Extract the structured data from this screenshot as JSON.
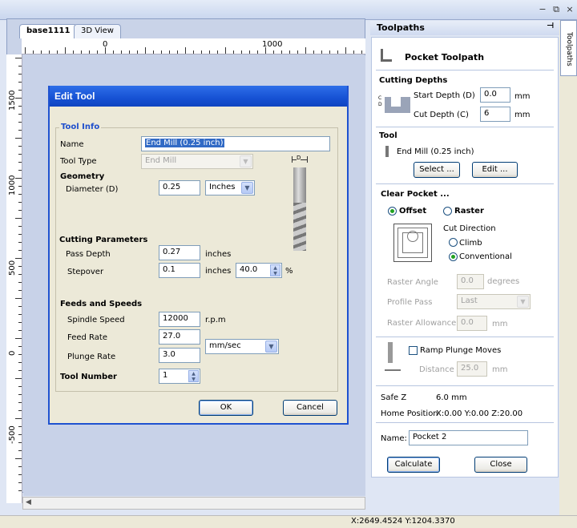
{
  "window": {
    "controls": [
      "−",
      "⧉",
      "×"
    ]
  },
  "document": {
    "tabs": [
      "base1111",
      "3D View"
    ],
    "ruler_h_labels": [
      "0",
      "1000"
    ],
    "ruler_v_labels": [
      "1500",
      "1000",
      "500",
      "0",
      "-500"
    ]
  },
  "status": {
    "coords": "X:2649.4524 Y:1204.3370"
  },
  "dialog": {
    "title": "Edit Tool",
    "tool_info_header": "Tool Info",
    "name_label": "Name",
    "name_value": "End Mill (0.25 inch)",
    "tool_type_label": "Tool Type",
    "tool_type_value": "End Mill",
    "geometry_header": "Geometry",
    "diameter_label": "Diameter (D)",
    "diameter_value": "0.25",
    "units_value": "Inches",
    "diagram_label": "D",
    "cutting_header": "Cutting Parameters",
    "pass_depth_label": "Pass Depth",
    "pass_depth_value": "0.27",
    "pass_depth_unit": "inches",
    "stepover_label": "Stepover",
    "stepover_value": "0.1",
    "stepover_unit": "inches",
    "stepover_percent": "40.0",
    "percent_sign": "%",
    "feeds_header": "Feeds and Speeds",
    "spindle_label": "Spindle Speed",
    "spindle_value": "12000",
    "spindle_unit": "r.p.m",
    "feed_label": "Feed Rate",
    "feed_value": "27.0",
    "plunge_label": "Plunge Rate",
    "plunge_value": "3.0",
    "rate_unit": "mm/sec",
    "tool_number_label": "Tool Number",
    "tool_number_value": "1",
    "ok_label": "OK",
    "cancel_label": "Cancel"
  },
  "panel": {
    "header": "Toolpaths",
    "pin": "⊣",
    "side_tab": "Toolpaths",
    "title": "Pocket Toolpath",
    "cutting_depths_header": "Cutting Depths",
    "start_depth_label": "Start Depth (D)",
    "start_depth_value": "0.0",
    "cut_depth_label": "Cut Depth (C)",
    "cut_depth_value": "6",
    "mm": "mm",
    "tool_header": "Tool",
    "tool_name": "End Mill (0.25 inch)",
    "select_label": "Select ...",
    "edit_label": "Edit ...",
    "clear_pocket_header": "Clear Pocket ...",
    "offset_label": "Offset",
    "raster_label": "Raster",
    "cut_direction_label": "Cut Direction",
    "climb_label": "Climb",
    "conventional_label": "Conventional",
    "raster_angle_label": "Raster Angle",
    "raster_angle_value": "0.0",
    "degrees": "degrees",
    "profile_pass_label": "Profile Pass",
    "profile_pass_value": "Last",
    "raster_allowance_label": "Raster Allowance",
    "raster_allowance_value": "0.0",
    "ramp_label": "Ramp Plunge Moves",
    "distance_label": "Distance",
    "distance_value": "25.0",
    "safe_z_label": "Safe Z",
    "safe_z_value": "6.0 mm",
    "home_label": "Home Position",
    "home_value": "X:0.00 Y:0.00 Z:20.00",
    "name_label": "Name:",
    "name_value": "Pocket 2",
    "calculate_label": "Calculate",
    "close_label": "Close"
  }
}
